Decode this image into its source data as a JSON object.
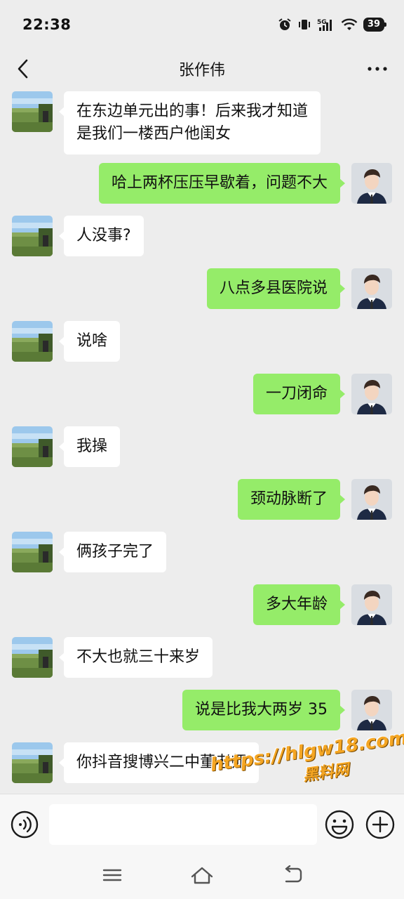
{
  "status_bar": {
    "time": "22:38",
    "battery": "39"
  },
  "header": {
    "title": "张作伟"
  },
  "messages": [
    {
      "side": "left",
      "text": "在东边单元出的事！后来我才知道\n是我们一楼西户他闺女"
    },
    {
      "side": "right",
      "text": "哈上两杯压压早歇着，问题不大"
    },
    {
      "side": "left",
      "text": "人没事?"
    },
    {
      "side": "right",
      "text": "八点多县医院说"
    },
    {
      "side": "left",
      "text": "说啥"
    },
    {
      "side": "right",
      "text": "一刀闭命"
    },
    {
      "side": "left",
      "text": "我操"
    },
    {
      "side": "right",
      "text": "颈动脉断了"
    },
    {
      "side": "left",
      "text": "俩孩子完了"
    },
    {
      "side": "right",
      "text": "多大年龄"
    },
    {
      "side": "left",
      "text": "不大也就三十来岁"
    },
    {
      "side": "right",
      "text": "说是比我大两岁 35"
    },
    {
      "side": "left",
      "text": "你抖音搜博兴二中董老师"
    }
  ],
  "input": {
    "value": ""
  },
  "watermark": {
    "url": "https://hlgw18.com",
    "label": "黑料网"
  },
  "colors": {
    "sent_bubble": "#95ec69",
    "received_bubble": "#ffffff",
    "background": "#ededed"
  }
}
